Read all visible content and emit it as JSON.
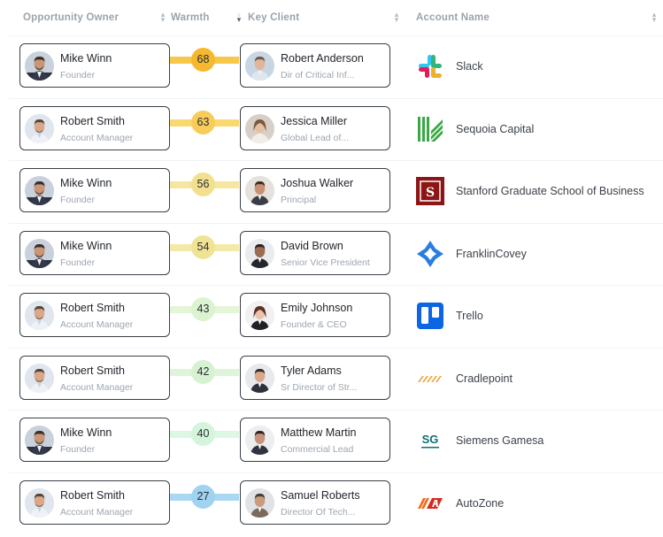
{
  "header": {
    "owner": "Opportunity Owner",
    "warmth": "Warmth",
    "client": "Key Client",
    "account": "Account Name"
  },
  "rows": [
    {
      "owner": {
        "name": "Mike Winn",
        "role": "Founder"
      },
      "warmth": "68",
      "warmth_color": "#f5b82e",
      "bar_color": "#f8c84a",
      "client": {
        "name": "Robert Anderson",
        "role": "Dir of Critical Inf..."
      },
      "account": "Slack",
      "logo": "slack-logo"
    },
    {
      "owner": {
        "name": "Robert Smith",
        "role": "Account Manager"
      },
      "warmth": "63",
      "warmth_color": "#f7cc5a",
      "bar_color": "#f9d870",
      "client": {
        "name": "Jessica Miller",
        "role": "Global Lead of..."
      },
      "account": "Sequoia Capital",
      "logo": "sequoia-logo"
    },
    {
      "owner": {
        "name": "Mike Winn",
        "role": "Founder"
      },
      "warmth": "56",
      "warmth_color": "#f3e08e",
      "bar_color": "#f5e6a2",
      "client": {
        "name": "Joshua Walker",
        "role": "Principal"
      },
      "account": "Stanford Graduate School of Business",
      "logo": "stanford-logo"
    },
    {
      "owner": {
        "name": "Mike Winn",
        "role": "Founder"
      },
      "warmth": "54",
      "warmth_color": "#f0e494",
      "bar_color": "#f3e9a8",
      "client": {
        "name": "David Brown",
        "role": "Senior Vice President"
      },
      "account": "FranklinCovey",
      "logo": "franklincovey-logo"
    },
    {
      "owner": {
        "name": "Robert Smith",
        "role": "Account Manager"
      },
      "warmth": "43",
      "warmth_color": "#dcf3cf",
      "bar_color": "#e3f6d8",
      "client": {
        "name": "Emily Johnson",
        "role": "Founder & CEO"
      },
      "account": "Trello",
      "logo": "trello-logo"
    },
    {
      "owner": {
        "name": "Robert Smith",
        "role": "Account Manager"
      },
      "warmth": "42",
      "warmth_color": "#d7f2d2",
      "bar_color": "#def5da",
      "client": {
        "name": "Tyler Adams",
        "role": "Sr Director of Str..."
      },
      "account": "Cradlepoint",
      "logo": "cradlepoint-logo"
    },
    {
      "owner": {
        "name": "Mike Winn",
        "role": "Founder"
      },
      "warmth": "40",
      "warmth_color": "#d4f5dc",
      "bar_color": "#dcf7e2",
      "client": {
        "name": "Matthew Martin",
        "role": "Commercial Lead"
      },
      "account": "Siemens Gamesa",
      "logo": "siemens-gamesa-logo"
    },
    {
      "owner": {
        "name": "Robert Smith",
        "role": "Account Manager"
      },
      "warmth": "27",
      "warmth_color": "#9fd3ef",
      "bar_color": "#a9d8f2",
      "client": {
        "name": "Samuel Roberts",
        "role": "Director Of Tech..."
      },
      "account": "AutoZone",
      "logo": "autozone-logo"
    }
  ]
}
